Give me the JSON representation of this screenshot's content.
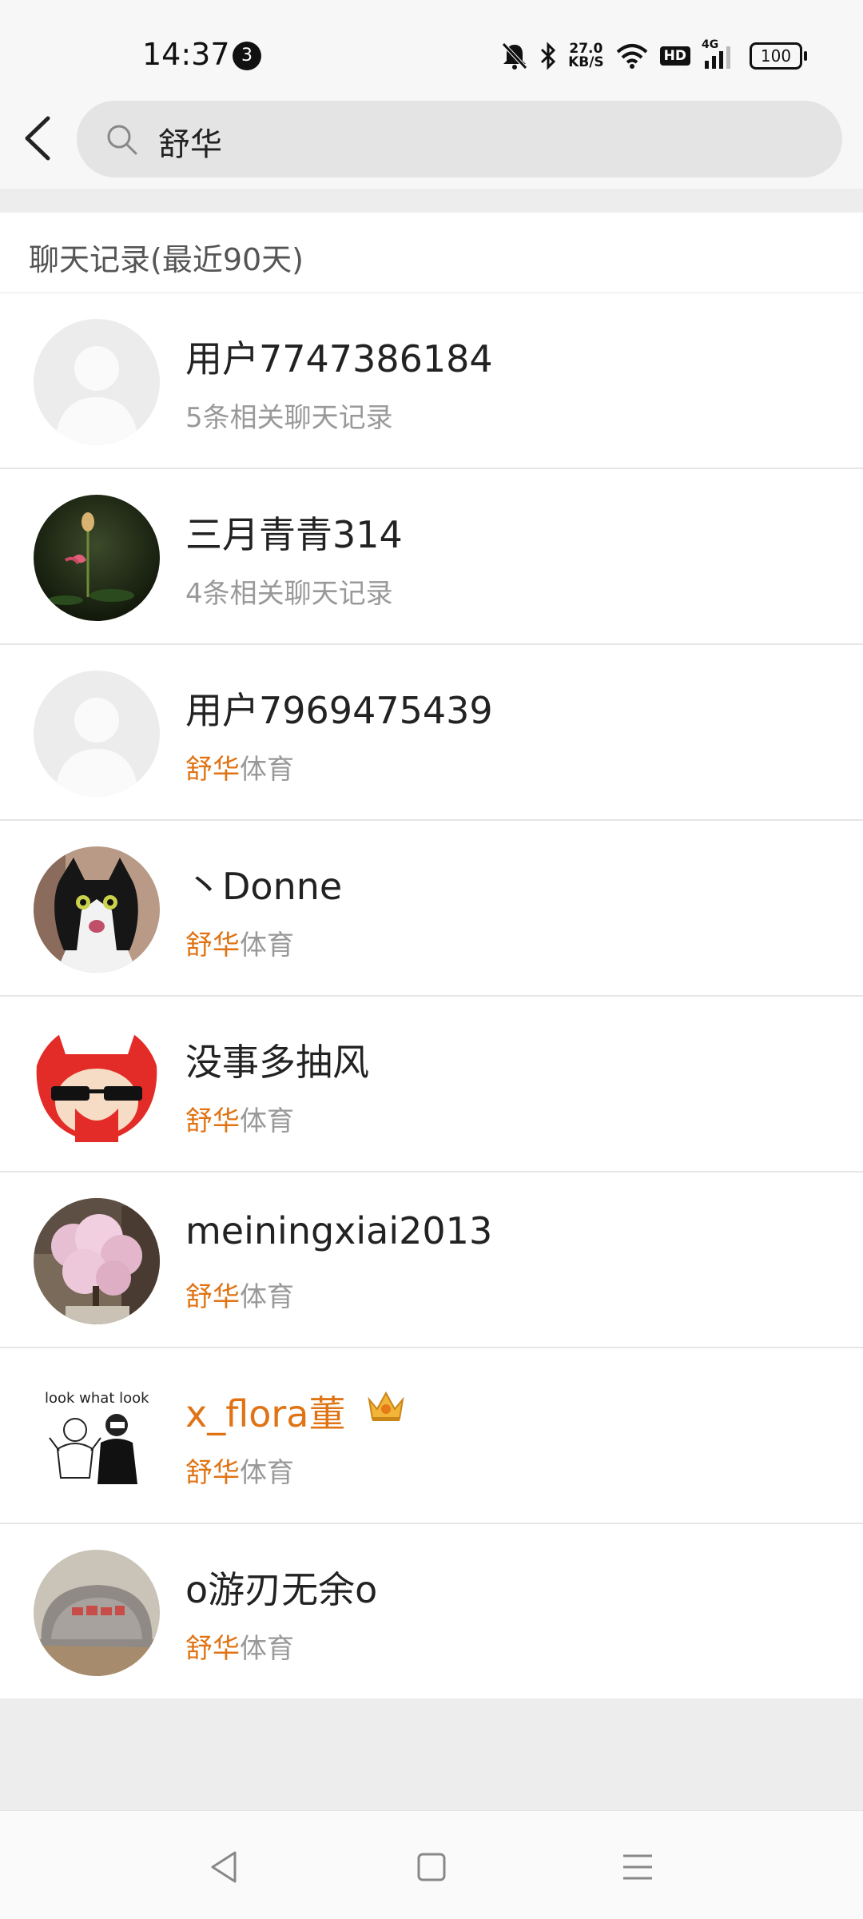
{
  "status_bar": {
    "time": "14:37",
    "notification_count": "3",
    "net_speed_value": "27.0",
    "net_speed_unit": "KB/S",
    "hd": "HD",
    "network": "4G",
    "battery": "100",
    "icons": [
      "mute-bell-icon",
      "bluetooth-icon",
      "wifi-icon",
      "signal-icon",
      "battery-icon"
    ]
  },
  "search": {
    "query": "舒华"
  },
  "section": {
    "label": "聊天记录(最近90天)"
  },
  "results": [
    {
      "name": "用户7747386184",
      "sub_plain": "5条相关聊天记录",
      "sub_highlight": "",
      "avatar": "default-avatar",
      "vip": false
    },
    {
      "name": "三月青青314",
      "sub_plain": "4条相关聊天记录",
      "sub_highlight": "",
      "avatar": "lotus-avatar",
      "vip": false
    },
    {
      "name": "用户7969475439",
      "sub_highlight": "舒华",
      "sub_plain": "体育",
      "avatar": "default-avatar",
      "vip": false
    },
    {
      "name": "丶Donne",
      "sub_highlight": "舒华",
      "sub_plain": "体育",
      "avatar": "cat-avatar",
      "vip": false
    },
    {
      "name": "没事多抽风",
      "sub_highlight": "舒华",
      "sub_plain": "体育",
      "avatar": "cartoon-avatar",
      "vip": false
    },
    {
      "name": "meiningxiai2013",
      "sub_highlight": "舒华",
      "sub_plain": "体育",
      "avatar": "blossom-avatar",
      "vip": false
    },
    {
      "name": "x_flora董",
      "sub_highlight": "舒华",
      "sub_plain": "体育",
      "avatar": "sketch-avatar",
      "vip": true,
      "sketch_text": "look what look"
    },
    {
      "name": "o游刃无余o",
      "sub_highlight": "舒华",
      "sub_plain": "体育",
      "avatar": "rock-avatar",
      "vip": false
    }
  ],
  "colors": {
    "highlight": "#e07415",
    "background": "#ededed",
    "list_bg": "#ffffff"
  },
  "nav": {
    "icons": [
      "back-triangle-icon",
      "home-square-icon",
      "menu-lines-icon"
    ]
  }
}
